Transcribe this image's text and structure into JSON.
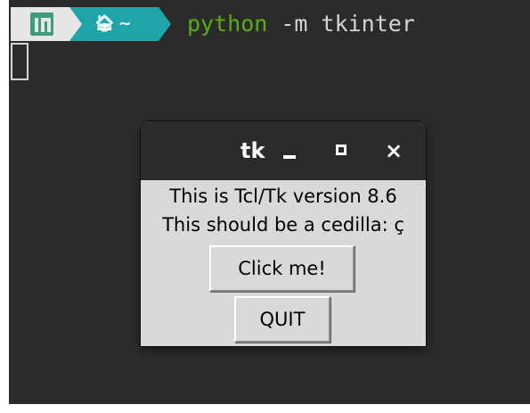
{
  "terminal": {
    "prompt": {
      "home_icon": "home-icon",
      "home_label": "~"
    },
    "command": {
      "name": "python",
      "args": " -m tkinter"
    }
  },
  "tk_window": {
    "title": "tk",
    "controls": {
      "minimize": "minimize-icon",
      "maximize": "maximize-icon",
      "close": "×"
    },
    "line1": "This is Tcl/Tk version 8.6",
    "line2": "This should be a cedilla: ç",
    "click_button": "Click me!",
    "quit_button": "QUIT"
  },
  "colors": {
    "terminal_bg": "#2b2b2b",
    "os_segment": "#e6e6e6",
    "home_segment": "#1fa5a8",
    "command_green": "#5aad12",
    "tk_bg": "#d9d9d9"
  }
}
